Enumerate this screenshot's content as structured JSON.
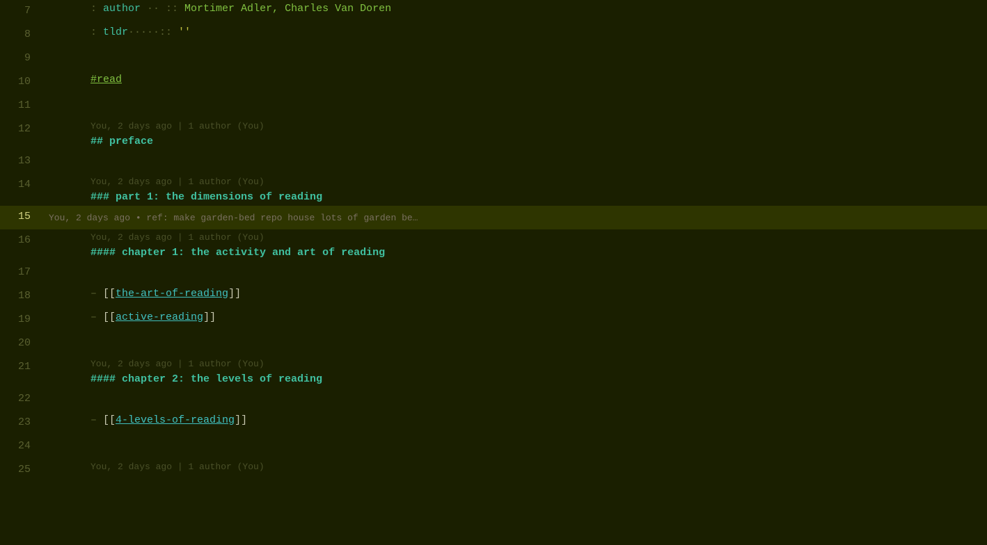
{
  "lines": [
    {
      "number": "7",
      "blame": null,
      "active": false,
      "code": [
        {
          "text": ": ",
          "class": "color-dim"
        },
        {
          "text": "author",
          "class": "color-cyan"
        },
        {
          "text": " ·· :: ",
          "class": "color-dim"
        },
        {
          "text": "Mortimer Adler, Charles Van Doren",
          "class": "color-green"
        }
      ]
    },
    {
      "number": "8",
      "blame": null,
      "active": false,
      "code": [
        {
          "text": ": ",
          "class": "color-dim"
        },
        {
          "text": "tldr",
          "class": "color-cyan"
        },
        {
          "text": "·····:: ",
          "class": "color-dim"
        },
        {
          "text": "''",
          "class": "color-yellow"
        }
      ]
    },
    {
      "number": "9",
      "blame": null,
      "active": false,
      "code": []
    },
    {
      "number": "10",
      "blame": null,
      "active": false,
      "code": [
        {
          "text": "#read",
          "class": "color-hash",
          "underline": true
        }
      ]
    },
    {
      "number": "11",
      "blame": null,
      "active": false,
      "code": []
    },
    {
      "number": "12",
      "blame": "You, 2 days ago | 1 author (You)",
      "active": false,
      "code": [
        {
          "text": "## ",
          "class": "color-heading"
        },
        {
          "text": "preface",
          "class": "color-heading"
        }
      ]
    },
    {
      "number": "13",
      "blame": null,
      "active": false,
      "code": []
    },
    {
      "number": "14",
      "blame": "You, 2 days ago | 1 author (You)",
      "active": false,
      "code": [
        {
          "text": "### ",
          "class": "color-heading"
        },
        {
          "text": "part 1: the dimensions of reading",
          "class": "color-heading"
        }
      ]
    },
    {
      "number": "15",
      "blame": null,
      "active": true,
      "active_blame": "You, 2 days ago • ref: make garden-bed repo house lots of garden be…",
      "code": []
    },
    {
      "number": "16",
      "blame": "You, 2 days ago | 1 author (You)",
      "active": false,
      "code": [
        {
          "text": "#### ",
          "class": "color-heading"
        },
        {
          "text": "chapter 1: the activity and art of reading",
          "class": "color-heading"
        }
      ]
    },
    {
      "number": "17",
      "blame": null,
      "active": false,
      "code": []
    },
    {
      "number": "18",
      "blame": null,
      "active": false,
      "code": [
        {
          "text": "– ",
          "class": "color-dim"
        },
        {
          "text": "[[",
          "class": "color-white"
        },
        {
          "text": "the-art-of-reading",
          "class": "color-link"
        },
        {
          "text": "]]",
          "class": "color-white"
        }
      ]
    },
    {
      "number": "19",
      "blame": null,
      "active": false,
      "code": [
        {
          "text": "– ",
          "class": "color-dim"
        },
        {
          "text": "[[",
          "class": "color-white"
        },
        {
          "text": "active-reading",
          "class": "color-link"
        },
        {
          "text": "]]",
          "class": "color-white"
        }
      ]
    },
    {
      "number": "20",
      "blame": null,
      "active": false,
      "code": []
    },
    {
      "number": "21",
      "blame": "You, 2 days ago | 1 author (You)",
      "active": false,
      "code": [
        {
          "text": "#### ",
          "class": "color-heading"
        },
        {
          "text": "chapter 2: the levels of reading",
          "class": "color-heading"
        }
      ]
    },
    {
      "number": "22",
      "blame": null,
      "active": false,
      "code": []
    },
    {
      "number": "23",
      "blame": null,
      "active": false,
      "code": [
        {
          "text": "– ",
          "class": "color-dim"
        },
        {
          "text": "[[",
          "class": "color-white"
        },
        {
          "text": "4-levels-of-reading",
          "class": "color-link"
        },
        {
          "text": "]]",
          "class": "color-white"
        }
      ]
    },
    {
      "number": "24",
      "blame": null,
      "active": false,
      "code": []
    },
    {
      "number": "25",
      "blame": "You, 2 days ago | 1 author (You)",
      "active": false,
      "code": []
    }
  ]
}
